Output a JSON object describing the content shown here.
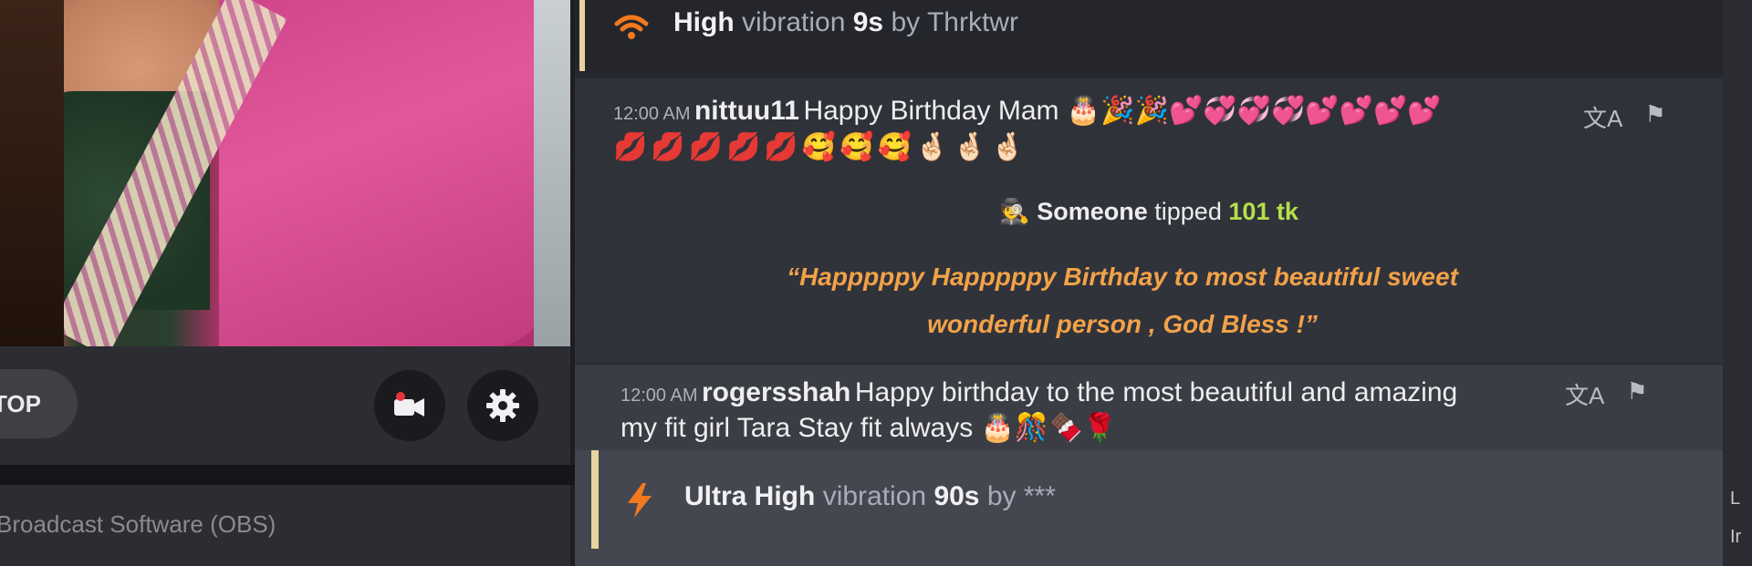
{
  "left": {
    "stop_label": "TOP",
    "obs_label": "Broadcast Software (OBS)"
  },
  "chat": {
    "vibe1": {
      "level": "High",
      "word": "vibration",
      "duration": "9s",
      "by": "by",
      "user": "Thrktwr",
      "icon": "wifi-signal-icon"
    },
    "msg1": {
      "time": "12:00 AM",
      "user": "nittuu11",
      "text": "Happy Birthday Mam 🎂🎉🎉💕💞💞💞💕💕💕💕",
      "emojis": "💋💋💋💋💋🥰🥰🥰🤞🏻🤞🏻🤞🏻"
    },
    "tip": {
      "who": "Someone",
      "verb": "tipped",
      "amount": "101 tk",
      "message": "“Happpppy Happpppy Birthday to most beautiful sweet wonderful person , God Bless !”",
      "icon": "incognito-icon"
    },
    "msg2": {
      "time": "12:00 AM",
      "user": "rogersshah",
      "text1": "Happy birthday to the most beautiful and amazing",
      "text2": "my fit girl Tara Stay fit always 🎂🎊🍫🌹"
    },
    "vibe2": {
      "level": "Ultra High",
      "word": "vibration",
      "duration": "90s",
      "by": "by",
      "user": "***",
      "icon": "lightning-icon"
    }
  },
  "edge": {
    "t1": "L",
    "t2": "Ir"
  },
  "colors": {
    "accent_orange": "#f2a248",
    "tip_green": "#b6e04a",
    "user_green": "#8ce04a",
    "user_purple": "#c79cf5"
  }
}
